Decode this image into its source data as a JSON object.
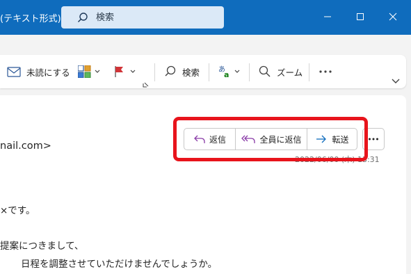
{
  "window": {
    "title": "(テキスト形式)",
    "search_placeholder": "検索"
  },
  "ribbon": {
    "mark_unread": "未読にする",
    "search": "検索",
    "zoom": "ズーム"
  },
  "message": {
    "sender_fragment": "nail.com>",
    "actions": {
      "reply": "返信",
      "reply_all": "全員に返信",
      "forward": "転送"
    },
    "date_partial": "2022/06/00 (木) 13:31",
    "body_lines": [
      "×です。",
      "提案につきまして、",
      "日程を調整させていただけませんでしょうか。"
    ]
  },
  "colors": {
    "titlebar": "#0f6cbd",
    "highlight": "#e8141c",
    "reply_icon": "#8a3ca8",
    "forward_icon": "#0f6cbd"
  }
}
